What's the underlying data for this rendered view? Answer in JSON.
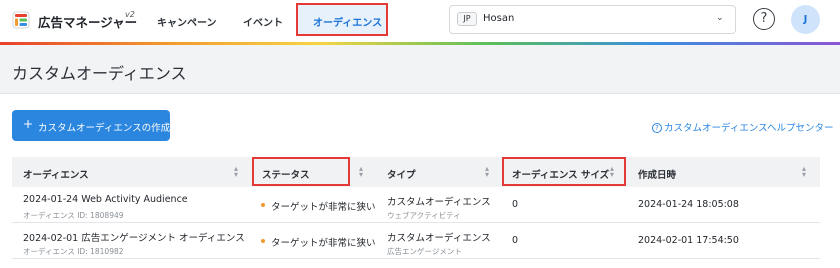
{
  "app": {
    "title": "広告マネージャー",
    "version": "v2"
  },
  "nav": {
    "items": [
      {
        "label": "キャンペーン"
      },
      {
        "label": "イベント"
      },
      {
        "label": "オーディエンス",
        "active": true
      }
    ]
  },
  "account": {
    "badge": "JP",
    "name": "Hosan"
  },
  "help": {
    "icon": "?"
  },
  "avatar": {
    "initial": "J"
  },
  "page": {
    "title": "カスタムオーディエンス"
  },
  "actions": {
    "create_label": "カスタムオーディエンスの作成",
    "help_link": "カスタムオーディエンスヘルプセンター"
  },
  "table": {
    "columns": [
      {
        "label": "オーディエンス"
      },
      {
        "label": "ステータス"
      },
      {
        "label": "タイプ"
      },
      {
        "label": "オーディエンス サイズ"
      },
      {
        "label": "作成日時"
      }
    ],
    "rows": [
      {
        "name": "2024-01-24 Web Activity Audience",
        "id": "オーディエンス ID: 1808949",
        "status": "ターゲットが非常に狭い",
        "type": "カスタムオーディエンス",
        "subtype": "ウェブアクティビティ",
        "size": "0",
        "created": "2024-01-24 18:05:08"
      },
      {
        "name": "2024-02-01 広告エンゲージメント オーディエンス",
        "id": "オーディエンス ID: 1810982",
        "status": "ターゲットが非常に狭い",
        "type": "カスタムオーディエンス",
        "subtype": "広告エンゲージメント",
        "size": "0",
        "created": "2024-02-01 17:54:50"
      }
    ]
  },
  "colors": {
    "accent": "#2b86e0",
    "highlight": "#e53935",
    "status_dot": "#f29a2e"
  }
}
